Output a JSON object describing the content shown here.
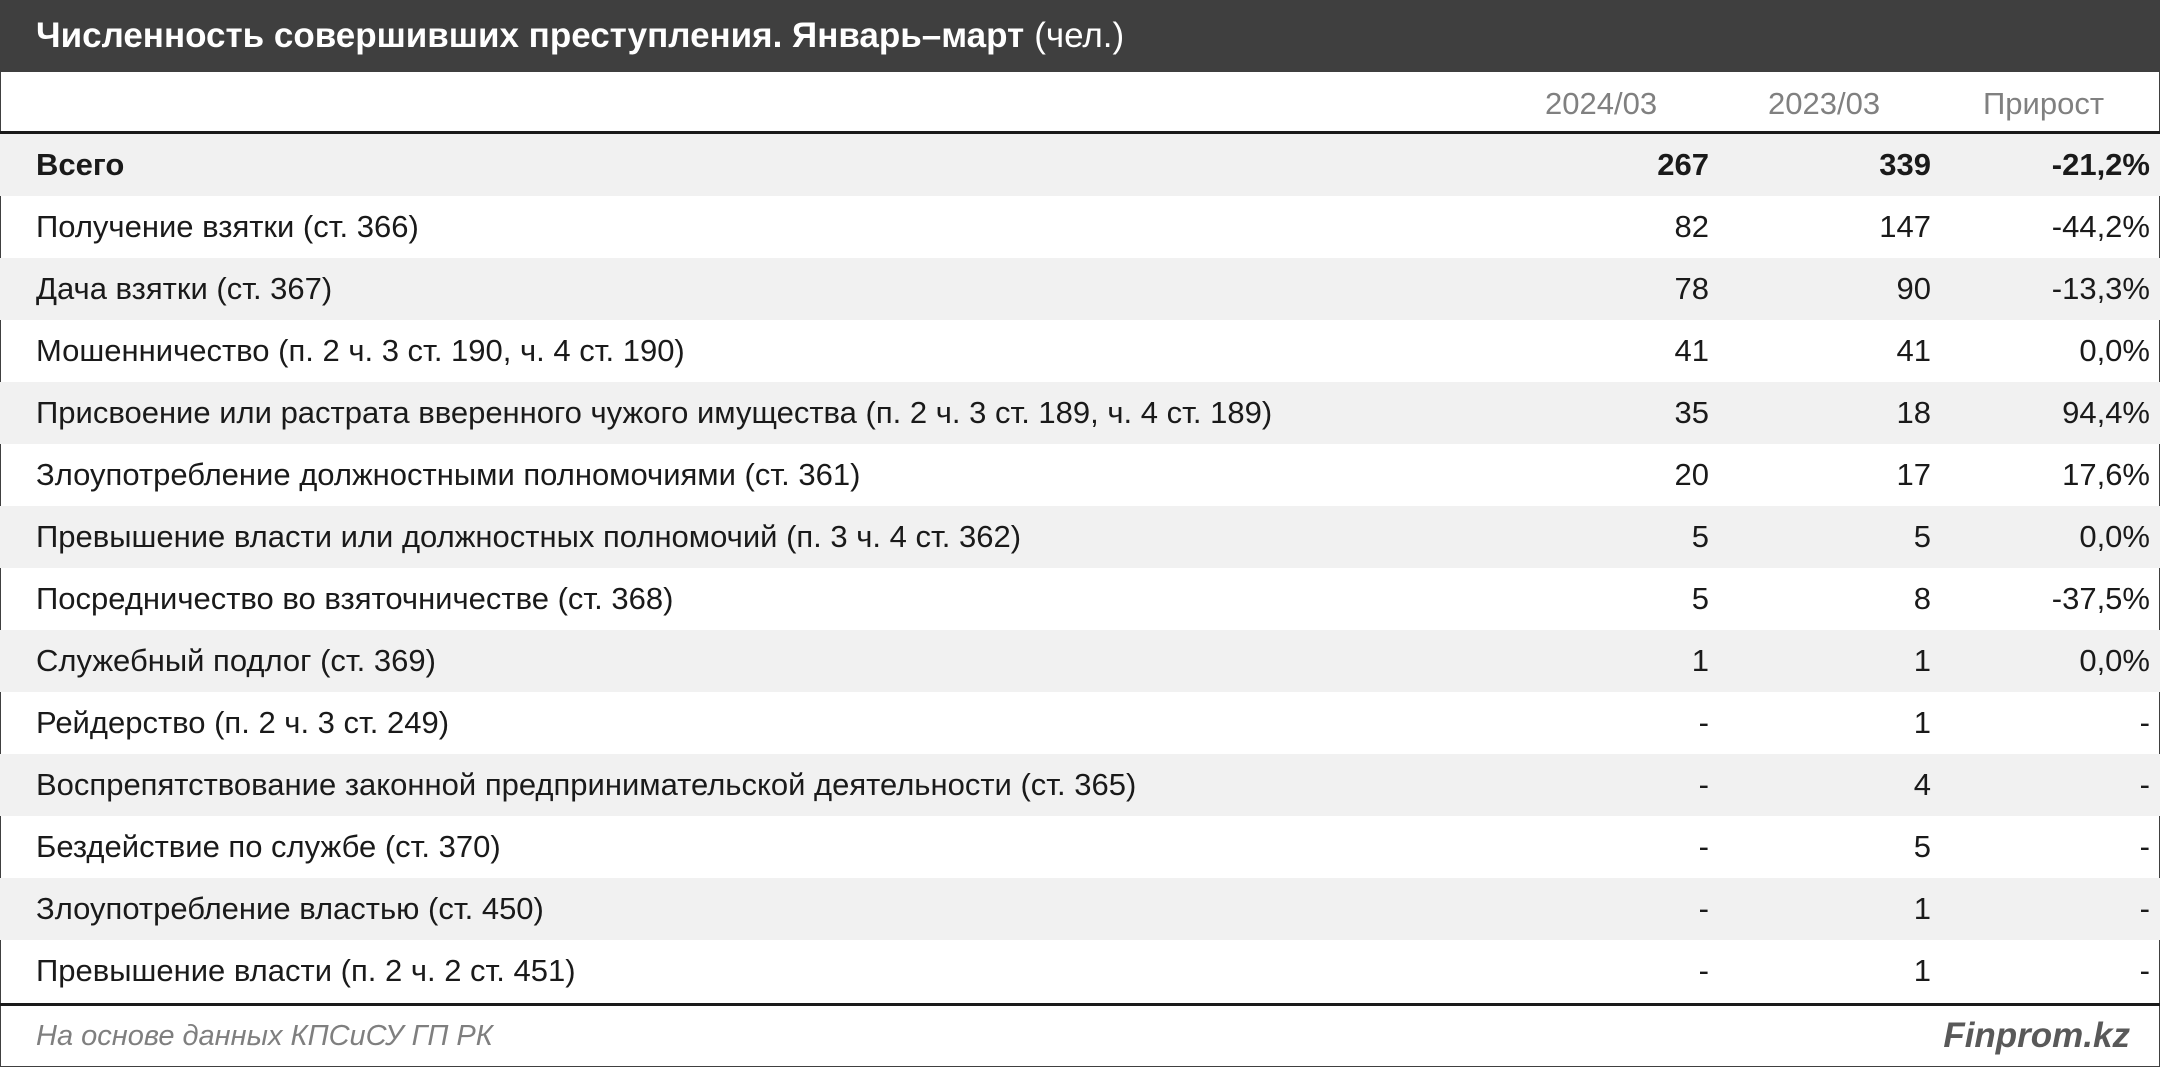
{
  "header": {
    "title": "Численность совершивших преступления. Январь–март",
    "unit": "(чел.)"
  },
  "columns": [
    "2024/03",
    "2023/03",
    "Прирост"
  ],
  "chart_data": {
    "type": "table",
    "title": "Численность совершивших преступления. Январь–март",
    "unit": "(чел.)",
    "columns": [
      "2024/03",
      "2023/03",
      "Прирост"
    ],
    "rows": [
      {
        "label": "Всего",
        "values": [
          "267",
          "339",
          "-21,2%"
        ],
        "total": true
      },
      {
        "label": "Получение взятки (ст. 366)",
        "values": [
          "82",
          "147",
          "-44,2%"
        ]
      },
      {
        "label": "Дача взятки (ст. 367)",
        "values": [
          "78",
          "90",
          "-13,3%"
        ]
      },
      {
        "label": "Мошенничество (п. 2 ч. 3 ст. 190, ч. 4 ст. 190)",
        "values": [
          "41",
          "41",
          "0,0%"
        ]
      },
      {
        "label": "Присвоение или растрата вверенного чужого имущества (п. 2 ч. 3 ст. 189, ч. 4 ст. 189)",
        "values": [
          "35",
          "18",
          "94,4%"
        ]
      },
      {
        "label": "Злоупотребление должностными полномочиями (ст. 361)",
        "values": [
          "20",
          "17",
          "17,6%"
        ]
      },
      {
        "label": "Превышение власти или должностных полномочий (п. 3 ч. 4 ст. 362)",
        "values": [
          "5",
          "5",
          "0,0%"
        ]
      },
      {
        "label": "Посредничество во взяточничестве (ст. 368)",
        "values": [
          "5",
          "8",
          "-37,5%"
        ]
      },
      {
        "label": "Служебный подлог (ст. 369)",
        "values": [
          "1",
          "1",
          "0,0%"
        ]
      },
      {
        "label": "Рейдерство (п. 2 ч. 3 ст. 249)",
        "values": [
          "-",
          "1",
          "-"
        ]
      },
      {
        "label": "Воспрепятствование законной предпринимательской деятельности (ст. 365)",
        "values": [
          "-",
          "4",
          "-"
        ]
      },
      {
        "label": "Бездействие по службе (ст. 370)",
        "values": [
          "-",
          "5",
          "-"
        ]
      },
      {
        "label": "Злоупотребление властью (ст. 450)",
        "values": [
          "-",
          "1",
          "-"
        ]
      },
      {
        "label": "Превышение власти (п. 2 ч. 2 ст. 451)",
        "values": [
          "-",
          "1",
          "-"
        ]
      }
    ]
  },
  "footer": {
    "source": "На основе данных КПСиСУ ГП РК",
    "brand": "Finprom.kz"
  },
  "colors": {
    "title_bg": "#3f3f3f",
    "row_shade": "#f1f1f1",
    "header_text": "#808080"
  }
}
